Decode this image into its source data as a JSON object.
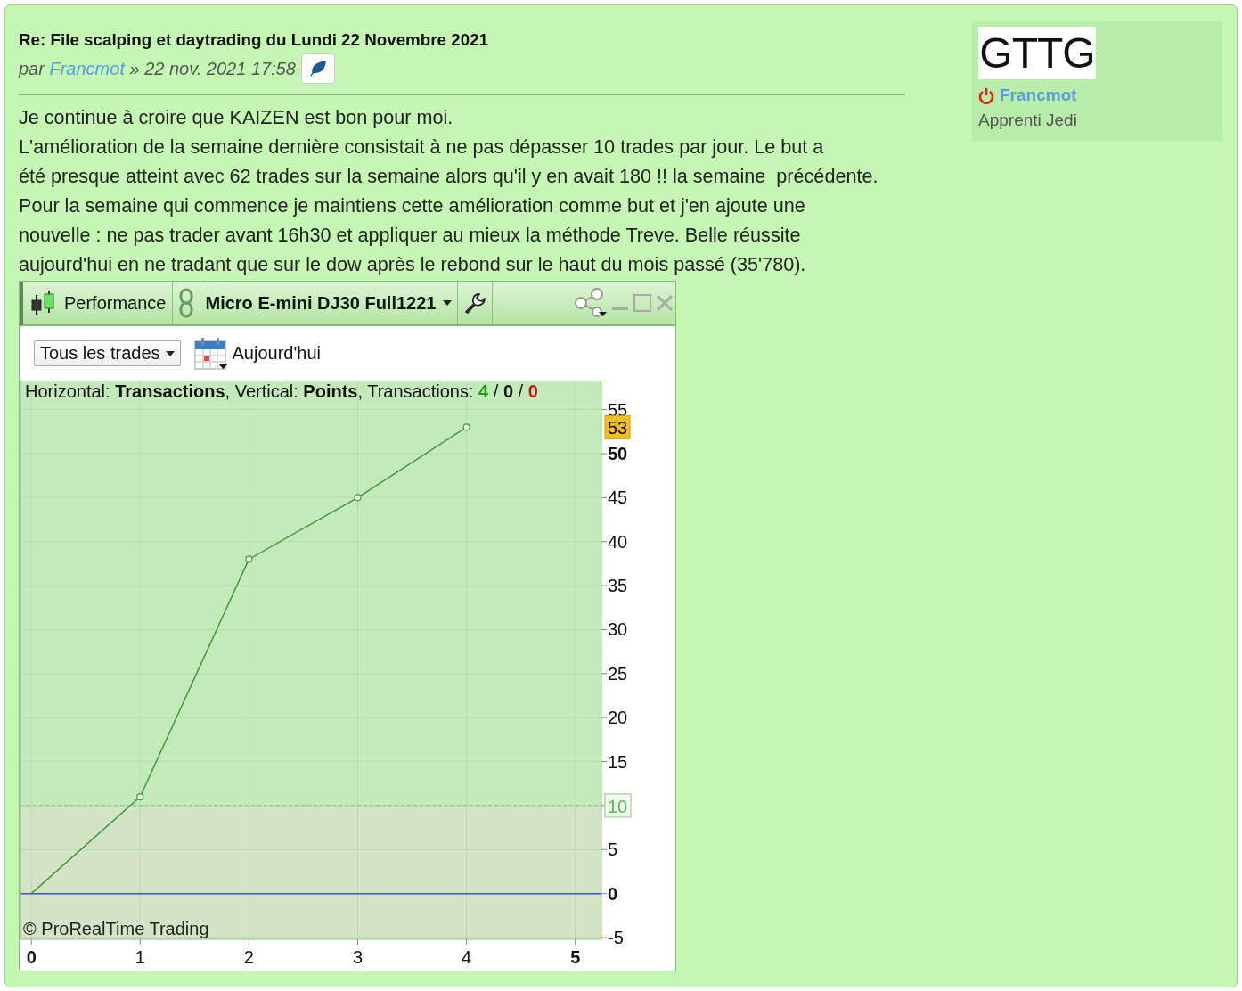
{
  "post": {
    "title": "Re: File scalping et daytrading du Lundi 22 Novembre 2021",
    "by": "par",
    "author": "Francmot",
    "date": "» 22 nov. 2021 17:58",
    "lines": [
      "Je continue à croire que KAIZEN est bon pour moi.",
      "L'amélioration de la semaine dernière consistait à ne pas dépasser 10 trades par jour. Le but a",
      "été presque atteint avec 62 trades sur la semaine alors qu'il y en avait 180 !! la semaine  précédente.",
      "Pour la semaine qui commence je maintiens cette amélioration comme but et j'en ajoute une",
      "nouvelle : ne pas trader avant 16h30 et appliquer au mieux la méthode Treve. Belle réussite",
      "aujourd'hui en ne tradant que sur le dow après le rebond sur le haut du mois passé (35'780)."
    ]
  },
  "profile": {
    "logo": "GTTG",
    "name": "Francmot",
    "online": false,
    "rank": "Apprenti Jedi"
  },
  "platform": {
    "tabs": [
      {
        "label": "Performance",
        "kind": "panel"
      },
      {
        "label": "Micro E-mini DJ30 Full1221",
        "kind": "instrument"
      }
    ],
    "filter": "Tous les trades",
    "period": "Aujourd'hui",
    "info": "Horizontal: **Transactions**, Vertical: **Points**, Transactions: ",
    "counts": [
      {
        "text": "4",
        "color": "#1f9a1f"
      },
      {
        "text": "0",
        "color": "#111111"
      },
      {
        "text": "0",
        "color": "#c01818"
      }
    ],
    "separator": " / ",
    "copyright": "© ProRealTime Trading",
    "chart_data": {
      "type": "line",
      "x": [
        0,
        1,
        2,
        3,
        4
      ],
      "series": [
        {
          "color": "#3f9a3a",
          "marker": "o",
          "values": [
            0,
            11,
            38,
            45,
            53
          ]
        }
      ],
      "xlim": [
        -0.1,
        5.24
      ],
      "ylim": [
        -5.2,
        58.3
      ],
      "xticks": [
        0,
        1,
        2,
        3,
        4,
        5
      ],
      "yticks": [
        -5,
        0,
        5,
        10,
        15,
        20,
        25,
        30,
        35,
        40,
        45,
        50,
        55
      ],
      "grid": true,
      "bands": [
        {
          "axis": "y",
          "from": 10,
          "to": 58.3,
          "color": "#c4eabb"
        },
        {
          "axis": "y",
          "from": -5.2,
          "to": 10,
          "color": "#d4e3c6"
        }
      ],
      "ref_lines": [
        {
          "axis": "y",
          "value": 10,
          "label": "10",
          "color": "#7cc87a"
        },
        {
          "axis": "y",
          "value": 0,
          "color": "#3c4fcc"
        }
      ],
      "annotations": [
        "53"
      ]
    }
  }
}
